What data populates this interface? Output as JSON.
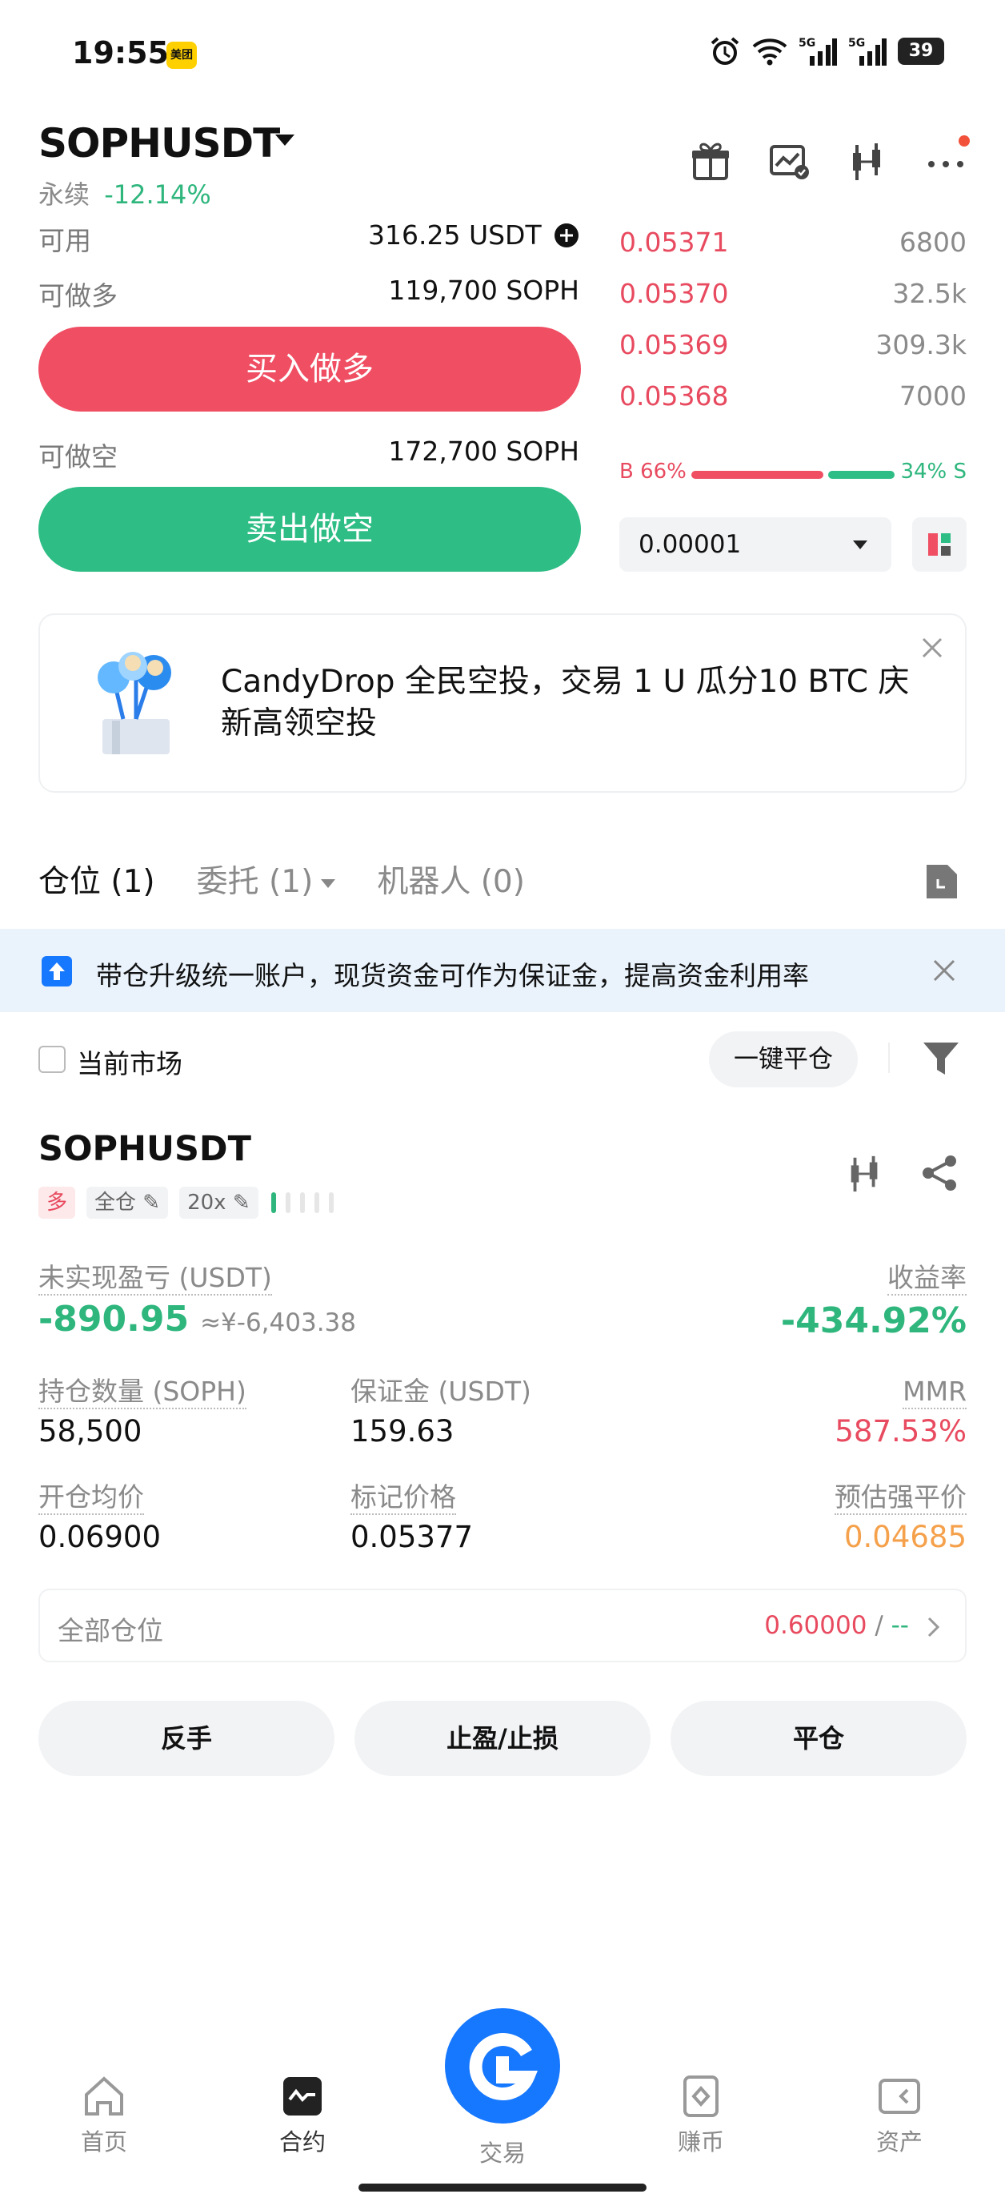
{
  "status_bar": {
    "time": "19:55",
    "app_badge": "美团",
    "battery": "39"
  },
  "header": {
    "pair": "SOPHUSDT",
    "market_type": "永续",
    "change": "-12.14%"
  },
  "trade_panel": {
    "available_label": "可用",
    "available_value": "316.25 USDT",
    "can_long_label": "可做多",
    "can_long_value": "119,700 SOPH",
    "buy_long_label": "买入做多",
    "can_short_label": "可做空",
    "can_short_value": "172,700 SOPH",
    "sell_short_label": "卖出做空"
  },
  "orderbook": {
    "asks": [
      {
        "price": "0.05371",
        "qty": "6800",
        "depth": 0.14
      },
      {
        "price": "0.05370",
        "qty": "32.5k",
        "depth": 0.15
      },
      {
        "price": "0.05369",
        "qty": "309.3k",
        "depth": 0.41
      },
      {
        "price": "0.05368",
        "qty": "7000",
        "depth": 0.58
      }
    ],
    "buy_ratio": "B 66%",
    "sell_ratio": "34% S",
    "buy_pct": 66,
    "precision": "0.00001"
  },
  "banner": {
    "text": "CandyDrop 全民空投，交易 1 U 瓜分10 BTC 庆新高领空投"
  },
  "tabs": [
    {
      "label": "仓位 (1)"
    },
    {
      "label": "委托 (1)"
    },
    {
      "label": "机器人 (0)"
    }
  ],
  "notice": {
    "text": "带仓升级统一账户，现货资金可作为保证金，提高资金利用率"
  },
  "filter": {
    "current_market": "当前市场",
    "close_all": "一键平仓"
  },
  "position": {
    "symbol": "SOPHUSDT",
    "side": "多",
    "margin_mode": "全仓",
    "leverage": "20x",
    "unrealized_pnl_label": "未实现盈亏 (USDT)",
    "unrealized_pnl": "-890.95",
    "unrealized_pnl_cny": "≈¥-6,403.38",
    "roe_label": "收益率",
    "roe": "-434.92%",
    "size_label": "持仓数量 (SOPH)",
    "size": "58,500",
    "margin_label": "保证金 (USDT)",
    "margin": "159.63",
    "mmr_label": "MMR",
    "mmr": "587.53%",
    "entry_label": "开仓均价",
    "entry": "0.06900",
    "mark_label": "标记价格",
    "mark": "0.05377",
    "liq_label": "预估强平价",
    "liq": "0.04685",
    "all_positions_label": "全部仓位",
    "all_positions_value": "0.60000",
    "all_positions_sep": "/",
    "all_positions_extra": "--"
  },
  "actions": {
    "reverse": "反手",
    "tpsl": "止盈/止损",
    "close": "平仓"
  },
  "nav": [
    {
      "label": "首页",
      "icon": "home-icon"
    },
    {
      "label": "合约",
      "icon": "futures-icon"
    },
    {
      "label": "交易",
      "icon": "trade-icon"
    },
    {
      "label": "赚币",
      "icon": "earn-icon"
    },
    {
      "label": "资产",
      "icon": "wallet-icon"
    }
  ],
  "colors": {
    "red": "#f04e63",
    "green": "#2dbd85",
    "blue": "#1677ff",
    "orange": "#f5a04a"
  }
}
